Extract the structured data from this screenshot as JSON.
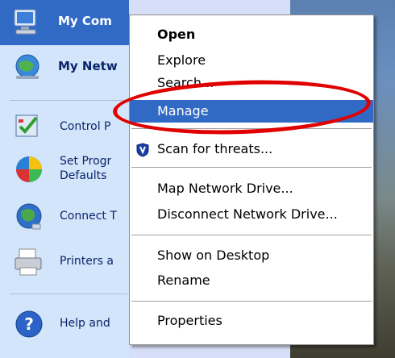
{
  "start_menu": {
    "items": [
      {
        "label": "My Com",
        "icon": "my-computer-icon",
        "bold": true,
        "highlighted": true
      },
      {
        "label": "My Netw",
        "icon": "my-network-places-icon",
        "bold": true
      },
      {
        "label": "Control P",
        "icon": "control-panel-icon"
      },
      {
        "label_line1": "Set Progr",
        "label_line2": "Defaults",
        "icon": "set-program-defaults-icon"
      },
      {
        "label": "Connect T",
        "icon": "connect-to-icon"
      },
      {
        "label": "Printers a",
        "icon": "printers-icon"
      },
      {
        "label": "Help and",
        "icon": "help-icon"
      }
    ]
  },
  "context_menu": {
    "open": "Open",
    "explore": "Explore",
    "search": "Search...",
    "manage": "Manage",
    "scan": "Scan for threats...",
    "map_drive": "Map Network Drive...",
    "disconnect_drive": "Disconnect Network Drive...",
    "show_desktop": "Show on Desktop",
    "rename": "Rename",
    "properties": "Properties"
  },
  "colors": {
    "highlight": "#316ac5",
    "annotation": "#e00000",
    "start_pane": "#d3e5fa"
  }
}
